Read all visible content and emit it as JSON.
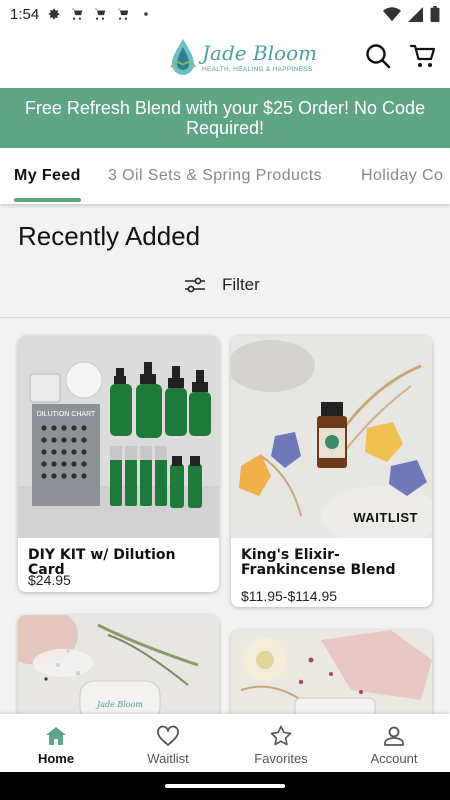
{
  "status_bar": {
    "time": "1:54"
  },
  "header": {
    "logo_title": "Jade Bloom",
    "logo_subtitle": "HEALTH, HEALING & HAPPINESS"
  },
  "banner": {
    "text": "Free Refresh Blend with your $25 Order! No Code Required!"
  },
  "tabs": [
    {
      "label": "My Feed",
      "active": true
    },
    {
      "label": "3 Oil Sets & Spring Products",
      "active": false
    },
    {
      "label": "Holiday Co",
      "active": false
    }
  ],
  "section": {
    "title": "Recently Added",
    "filter_label": "Filter"
  },
  "products": [
    {
      "name": "DIY KIT w/ Dilution Card",
      "price": "$24.95",
      "badge": ""
    },
    {
      "name": "King's Elixir- Frankincense Blend",
      "price": "$11.95-$114.95",
      "badge": "WAITLIST"
    },
    {
      "name": "",
      "price": "",
      "badge": ""
    },
    {
      "name": "",
      "price": "",
      "badge": ""
    }
  ],
  "product_image_text": {
    "dilution_chart": "DILUTION CHART",
    "jar_label": "Jade Bloom"
  },
  "bottom_nav": [
    {
      "label": "Home",
      "icon": "home-icon",
      "active": true
    },
    {
      "label": "Waitlist",
      "icon": "heart-icon",
      "active": false
    },
    {
      "label": "Favorites",
      "icon": "star-icon",
      "active": false
    },
    {
      "label": "Account",
      "icon": "account-icon",
      "active": false
    }
  ],
  "colors": {
    "accent": "#5fa585",
    "brand": "#4d9fa0"
  }
}
